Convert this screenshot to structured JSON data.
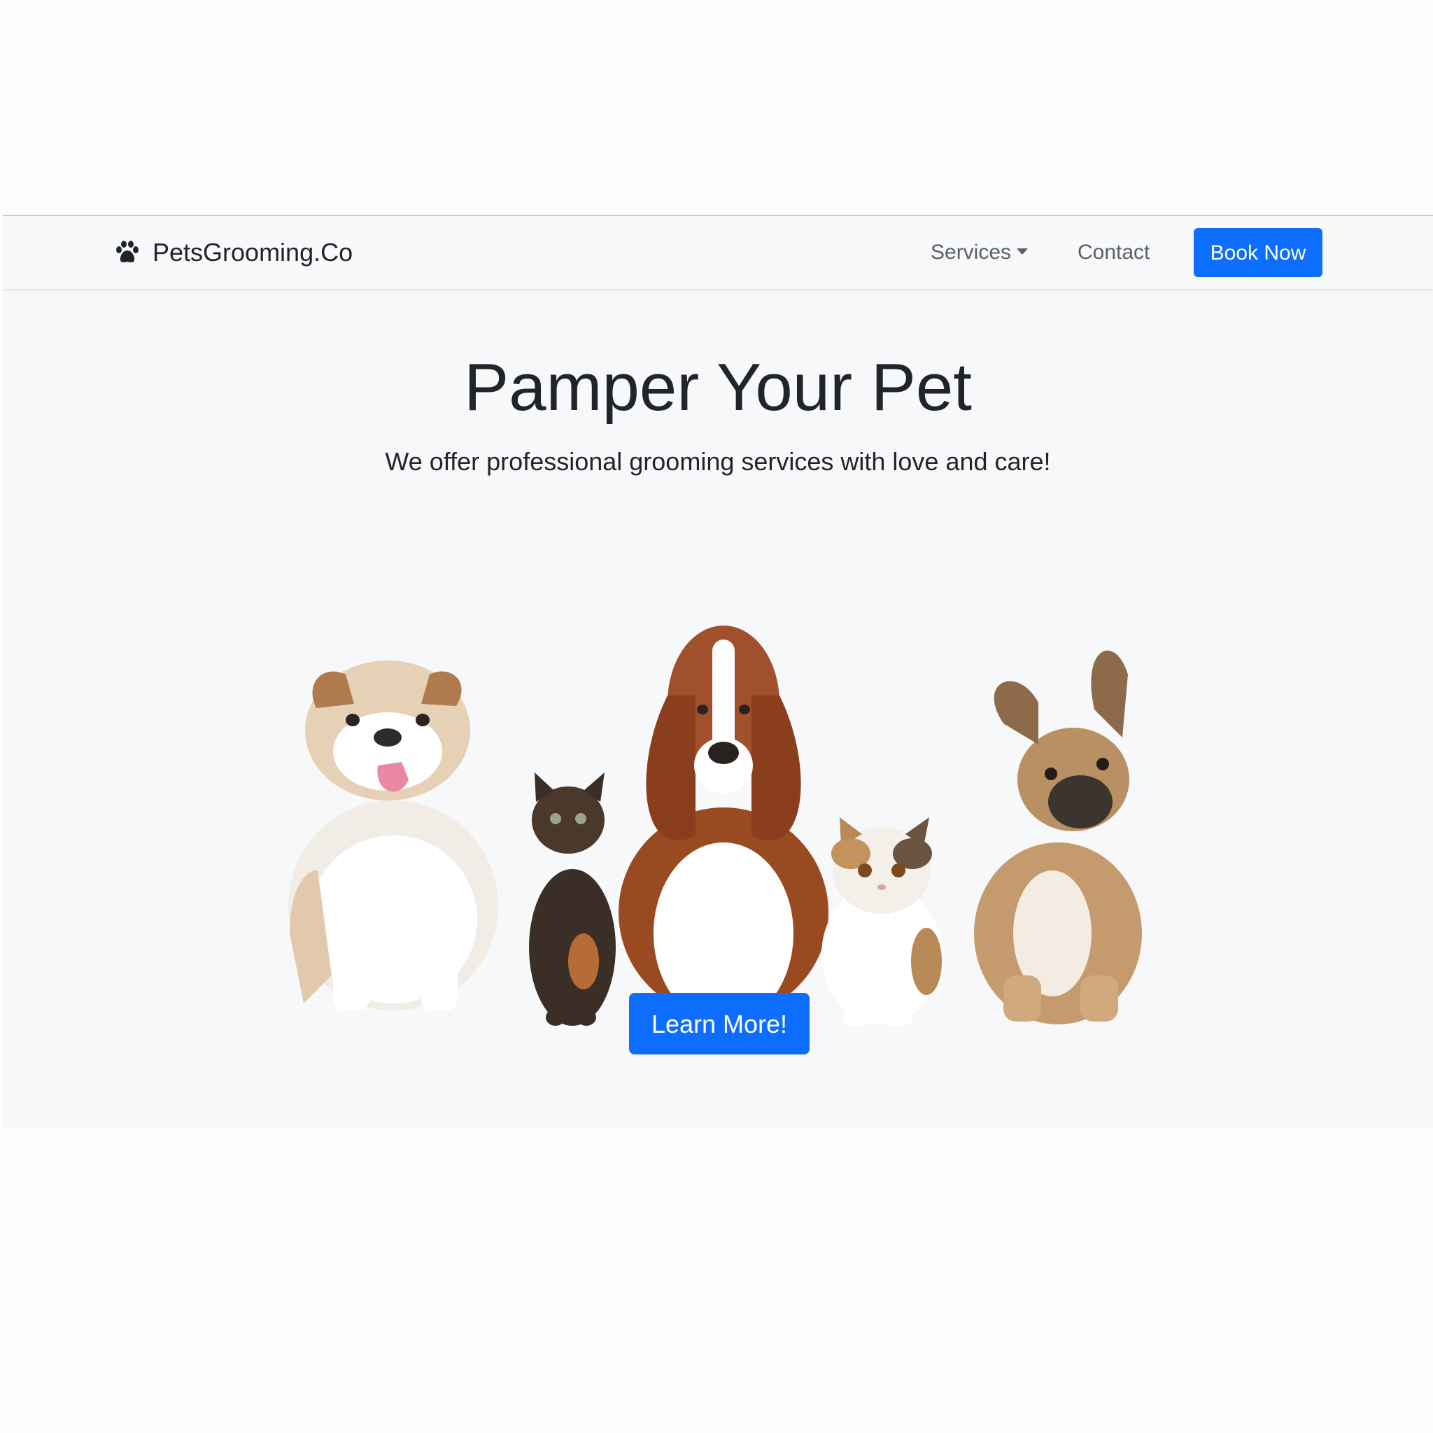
{
  "navbar": {
    "brand_icon": "paw-icon",
    "brand_name": "PetsGrooming.Co",
    "links": {
      "services": "Services",
      "contact": "Contact"
    },
    "cta": "Book Now"
  },
  "hero": {
    "title": "Pamper Your Pet",
    "subtitle": "We offer professional grooming services with love and care!",
    "image": "pets-group-photo",
    "button": "Learn More!"
  },
  "colors": {
    "primary": "#0d6efd",
    "navbar_bg": "#f8f9fa",
    "hero_bg": "#f7f8fa",
    "text": "#212529",
    "nav_link": "#5b6066"
  }
}
